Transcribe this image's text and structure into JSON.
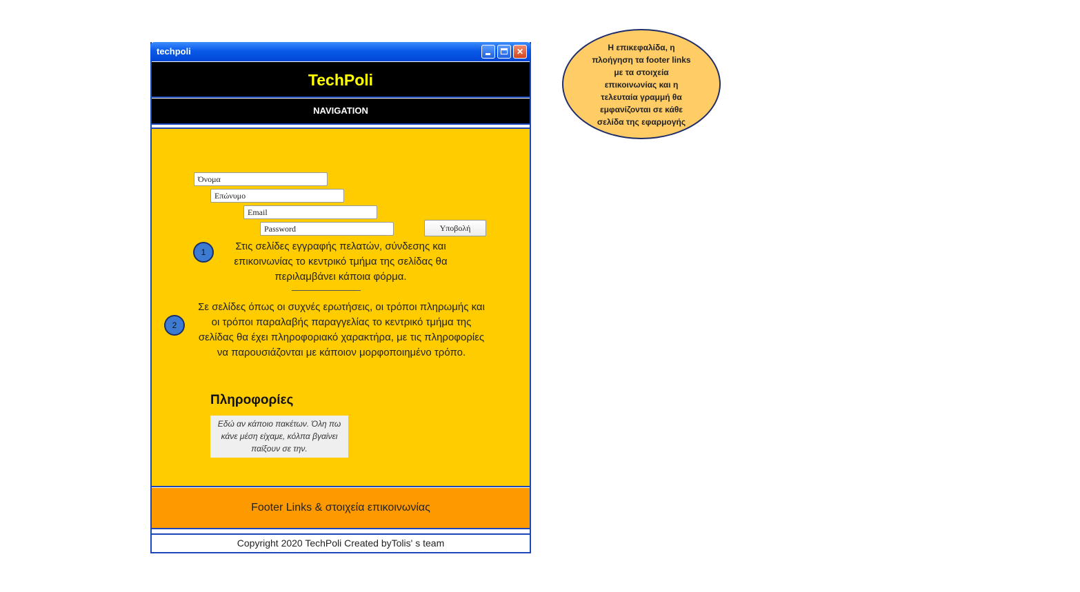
{
  "window": {
    "title": "techpoli"
  },
  "header": {
    "brand": "TechPoli",
    "brand_color": "#ffff00"
  },
  "nav": {
    "label": "NAVIGATION"
  },
  "form": {
    "first_name_placeholder": "Όνομα",
    "last_name_placeholder": "Επώνυμο",
    "email_placeholder": "Email",
    "password_placeholder": "Password",
    "submit_label": "Υποβολή"
  },
  "notes": [
    {
      "number": "1",
      "text": "Στις σελίδες εγγραφής πελατών, σύνδεσης και επικοινωνίας το κεντρικό τμήμα της σελίδας θα περιλαμβάνει κάποια φόρμα."
    },
    {
      "number": "2",
      "text": "Σε σελίδες όπως οι συχνές ερωτήσεις, οι τρόποι πληρωμής και οι τρόποι παραλαβής παραγγελίας το κεντρικό τμήμα της σελίδας θα έχει πληροφοριακό χαρακτήρα, με τις πληροφορίες να παρουσιάζονται με κάποιον μορφοποιημένο τρόπο."
    }
  ],
  "info": {
    "title": "Πληροφορίες",
    "body": "Εδώ αν κάποιο πακέτων. Όλη πω κάνε μέση είχαμε, κόλπα βγαίνει παίξουν σε την."
  },
  "footer": {
    "links_label": "Footer Links & στοιχεία επικοινωνίας",
    "copyright": "Copyright 2020 TechPoli Created byTolis' s team"
  },
  "callout": {
    "text": "Η επικεφαλίδα, η πλοήγηση τα footer links με τα στοιχεία επικοινωνίας και η τελευταία γραμμή θα εμφανίζονται σε κάθε σελίδα της εφαρμογής"
  },
  "colors": {
    "main_bg": "#ffcc00",
    "footer_bg": "#ff9900",
    "callout_bg": "#ffcc66",
    "marker_bg": "#3d7ad1",
    "frame": "#1b47b8"
  }
}
